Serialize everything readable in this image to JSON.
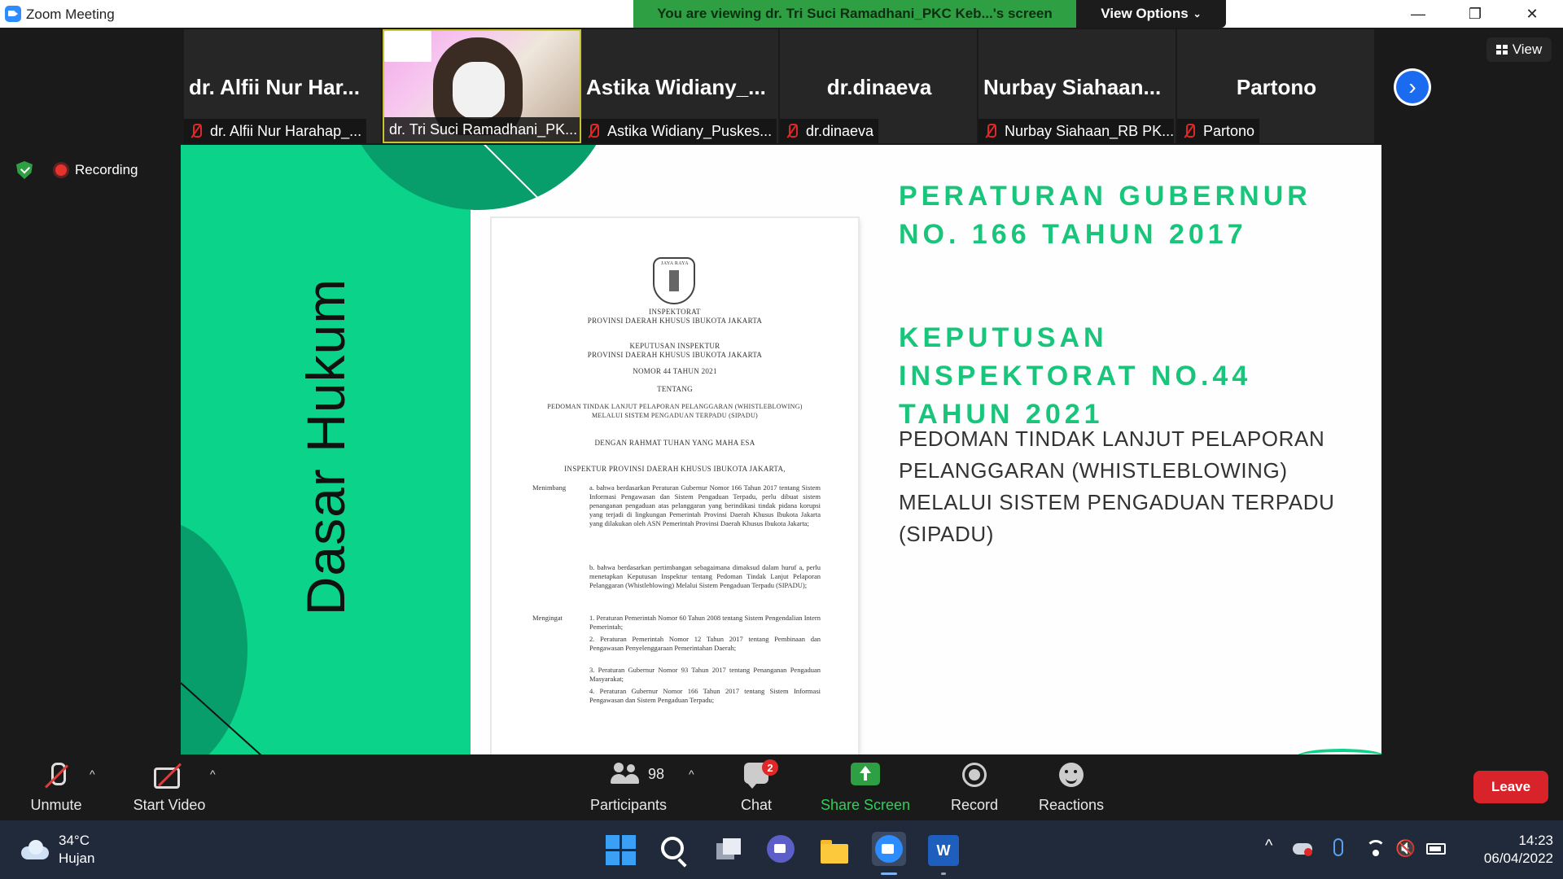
{
  "window": {
    "title": "Zoom Meeting",
    "share_banner": "You are viewing dr. Tri Suci Ramadhani_PKC Keb...'s screen",
    "view_options_label": "View Options",
    "minimize_glyph": "—",
    "restore_glyph": "❐",
    "close_glyph": "✕"
  },
  "participants_strip": [
    {
      "big_name": "dr. Alfii Nur Har...",
      "label": "dr. Alfii Nur Harahap_...",
      "muted": true
    },
    {
      "big_name": "",
      "label": "dr. Tri Suci Ramadhani_PK...",
      "muted": false,
      "video": true
    },
    {
      "big_name": "Astika  Widiany_...",
      "label": "Astika Widiany_Puskes...",
      "muted": true
    },
    {
      "big_name": "dr.dinaeva",
      "label": "dr.dinaeva",
      "muted": true
    },
    {
      "big_name": "Nurbay  Siahaan...",
      "label": "Nurbay Siahaan_RB PK...",
      "muted": true
    },
    {
      "big_name": "Partono",
      "label": "Partono",
      "muted": true
    }
  ],
  "view_button_label": "View",
  "recording_label": "Recording",
  "slide": {
    "vertical_title": "Dasar Hukum",
    "heading1_line1": "PERATURAN GUBERNUR",
    "heading1_line2": "NO. 166 TAHUN 2017",
    "heading2_line1": "KEPUTUSAN",
    "heading2_line2": "INSPEKTORAT NO.44",
    "heading2_line3": "TAHUN 2021",
    "sub_line1": "PEDOMAN TINDAK LANJUT PELAPORAN",
    "sub_line2": "PELANGGARAN (WHISTLEBLOWING)",
    "sub_line3": "MELALUI SISTEM PENGADUAN TERPADU",
    "sub_line4": "(SIPADU)",
    "document": {
      "seal_caption": "JAYA RAYA",
      "org_line1": "INSPEKTORAT",
      "org_line2": "PROVINSI DAERAH KHUSUS IBUKOTA JAKARTA",
      "decree_line1": "KEPUTUSAN INSPEKTUR",
      "decree_line2": "PROVINSI DAERAH KHUSUS IBUKOTA JAKARTA",
      "number_line": "NOMOR  44  TAHUN 2021",
      "about": "TENTANG",
      "subject_line1": "PEDOMAN TINDAK LANJUT PELAPORAN PELANGGARAN (WHISTLEBLOWING)",
      "subject_line2": "MELALUI SISTEM PENGADUAN TERPADU (SIPADU)",
      "blessing": "DENGAN RAHMAT TUHAN YANG MAHA ESA",
      "official": "INSPEKTUR PROVINSI DAERAH KHUSUS IBUKOTA JAKARTA,",
      "menimbang_label": "Menimbang",
      "menimbang_a": "a.  bahwa berdasarkan Peraturan Gubernur Nomor 166 Tahun 2017 tentang Sistem Informasi Pengawasan dan Sistem Pengaduan Terpadu, perlu dibuat sistem penanganan pengaduan atas pelanggaran yang berindikasi tindak pidana korupsi yang terjadi di lingkungan Pemerintah Provinsi Daerah Khusus Ibukota Jakarta yang dilakukan oleh ASN Pemerintah Provinsi Daerah Khusus Ibukota Jakarta;",
      "menimbang_b": "b.  bahwa berdasarkan pertimbangan sebagaimana dimaksud dalam huruf a, perlu menetapkan Keputusan Inspektur tentang Pedoman Tindak Lanjut Pelaporan Pelanggaran (Whistleblowing) Melalui Sistem Pengaduan Terpadu (SIPADU);",
      "mengingat_label": "Mengingat",
      "mengingat_1": "1.  Peraturan Pemerintah Nomor 60 Tahun 2008 tentang Sistem Pengendalian Intern Pemerintah;",
      "mengingat_2": "2.  Peraturan Pemerintah Nomor 12 Tahun 2017 tentang Pembinaan dan Pengawasan Penyelenggaraan Pemerintahan Daerah;",
      "mengingat_3": "3.  Peraturan Gubernur Nomor 93 Tahun 2017 tentang Penanganan Pengaduan Masyarakat;",
      "mengingat_4": "4.  Peraturan Gubernur Nomor 166 Tahun 2017 tentang Sistem Informasi Pengawasan dan Sistem Pengaduan Terpadu;"
    }
  },
  "toolbar": {
    "unmute_label": "Unmute",
    "start_video_label": "Start Video",
    "participants_label": "Participants",
    "participants_count": "98",
    "chat_label": "Chat",
    "chat_badge": "2",
    "share_label": "Share Screen",
    "record_label": "Record",
    "reactions_label": "Reactions",
    "leave_label": "Leave",
    "caret_glyph": "^"
  },
  "taskbar": {
    "temperature": "34°C",
    "weather": "Hujan",
    "word_letter": "W",
    "time": "14:23",
    "date": "06/04/2022",
    "tray_chevron": "^"
  },
  "colors": {
    "slide_green": "#0bd38a",
    "heading_green": "#18c57a",
    "share_banner_green": "#2ea043",
    "leave_red": "#d9232b",
    "muted_red": "#e02828",
    "accent_blue": "#1a6bf0"
  }
}
